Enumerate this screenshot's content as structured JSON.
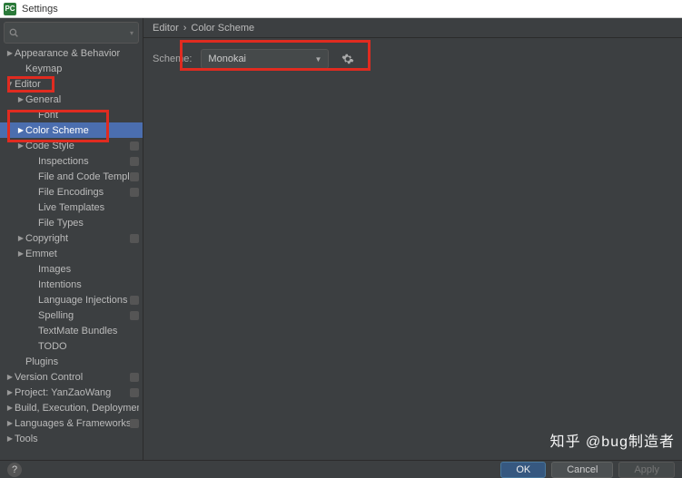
{
  "window": {
    "title": "Settings",
    "appicon": "PC"
  },
  "search": {
    "placeholder": ""
  },
  "tree": [
    {
      "label": "Appearance & Behavior",
      "depth": 0,
      "arrow": "▶",
      "badge": false,
      "selected": false
    },
    {
      "label": "Keymap",
      "depth": 1,
      "arrow": "",
      "badge": false,
      "selected": false
    },
    {
      "label": "Editor",
      "depth": 0,
      "arrow": "▼",
      "badge": false,
      "selected": false
    },
    {
      "label": "General",
      "depth": 1,
      "arrow": "▶",
      "badge": false,
      "selected": false
    },
    {
      "label": "Font",
      "depth": 2,
      "arrow": "",
      "badge": false,
      "selected": false
    },
    {
      "label": "Color Scheme",
      "depth": 1,
      "arrow": "▶",
      "badge": false,
      "selected": true
    },
    {
      "label": "Code Style",
      "depth": 1,
      "arrow": "▶",
      "badge": true,
      "selected": false
    },
    {
      "label": "Inspections",
      "depth": 2,
      "arrow": "",
      "badge": true,
      "selected": false
    },
    {
      "label": "File and Code Templates",
      "depth": 2,
      "arrow": "",
      "badge": true,
      "selected": false
    },
    {
      "label": "File Encodings",
      "depth": 2,
      "arrow": "",
      "badge": true,
      "selected": false
    },
    {
      "label": "Live Templates",
      "depth": 2,
      "arrow": "",
      "badge": false,
      "selected": false
    },
    {
      "label": "File Types",
      "depth": 2,
      "arrow": "",
      "badge": false,
      "selected": false
    },
    {
      "label": "Copyright",
      "depth": 1,
      "arrow": "▶",
      "badge": true,
      "selected": false
    },
    {
      "label": "Emmet",
      "depth": 1,
      "arrow": "▶",
      "badge": false,
      "selected": false
    },
    {
      "label": "Images",
      "depth": 2,
      "arrow": "",
      "badge": false,
      "selected": false
    },
    {
      "label": "Intentions",
      "depth": 2,
      "arrow": "",
      "badge": false,
      "selected": false
    },
    {
      "label": "Language Injections",
      "depth": 2,
      "arrow": "",
      "badge": true,
      "selected": false
    },
    {
      "label": "Spelling",
      "depth": 2,
      "arrow": "",
      "badge": true,
      "selected": false
    },
    {
      "label": "TextMate Bundles",
      "depth": 2,
      "arrow": "",
      "badge": false,
      "selected": false
    },
    {
      "label": "TODO",
      "depth": 2,
      "arrow": "",
      "badge": false,
      "selected": false
    },
    {
      "label": "Plugins",
      "depth": 1,
      "arrow": "",
      "badge": false,
      "selected": false
    },
    {
      "label": "Version Control",
      "depth": 0,
      "arrow": "▶",
      "badge": true,
      "selected": false
    },
    {
      "label": "Project: YanZaoWang",
      "depth": 0,
      "arrow": "▶",
      "badge": true,
      "selected": false
    },
    {
      "label": "Build, Execution, Deployment",
      "depth": 0,
      "arrow": "▶",
      "badge": false,
      "selected": false
    },
    {
      "label": "Languages & Frameworks",
      "depth": 0,
      "arrow": "▶",
      "badge": true,
      "selected": false
    },
    {
      "label": "Tools",
      "depth": 0,
      "arrow": "▶",
      "badge": false,
      "selected": false
    }
  ],
  "breadcrumb": {
    "a": "Editor",
    "sep": "›",
    "b": "Color Scheme"
  },
  "form": {
    "scheme_label": "Scheme:",
    "scheme_value": "Monokai"
  },
  "buttons": {
    "ok": "OK",
    "cancel": "Cancel",
    "apply": "Apply",
    "help": "?"
  },
  "watermark": "知乎 @bug制造者"
}
